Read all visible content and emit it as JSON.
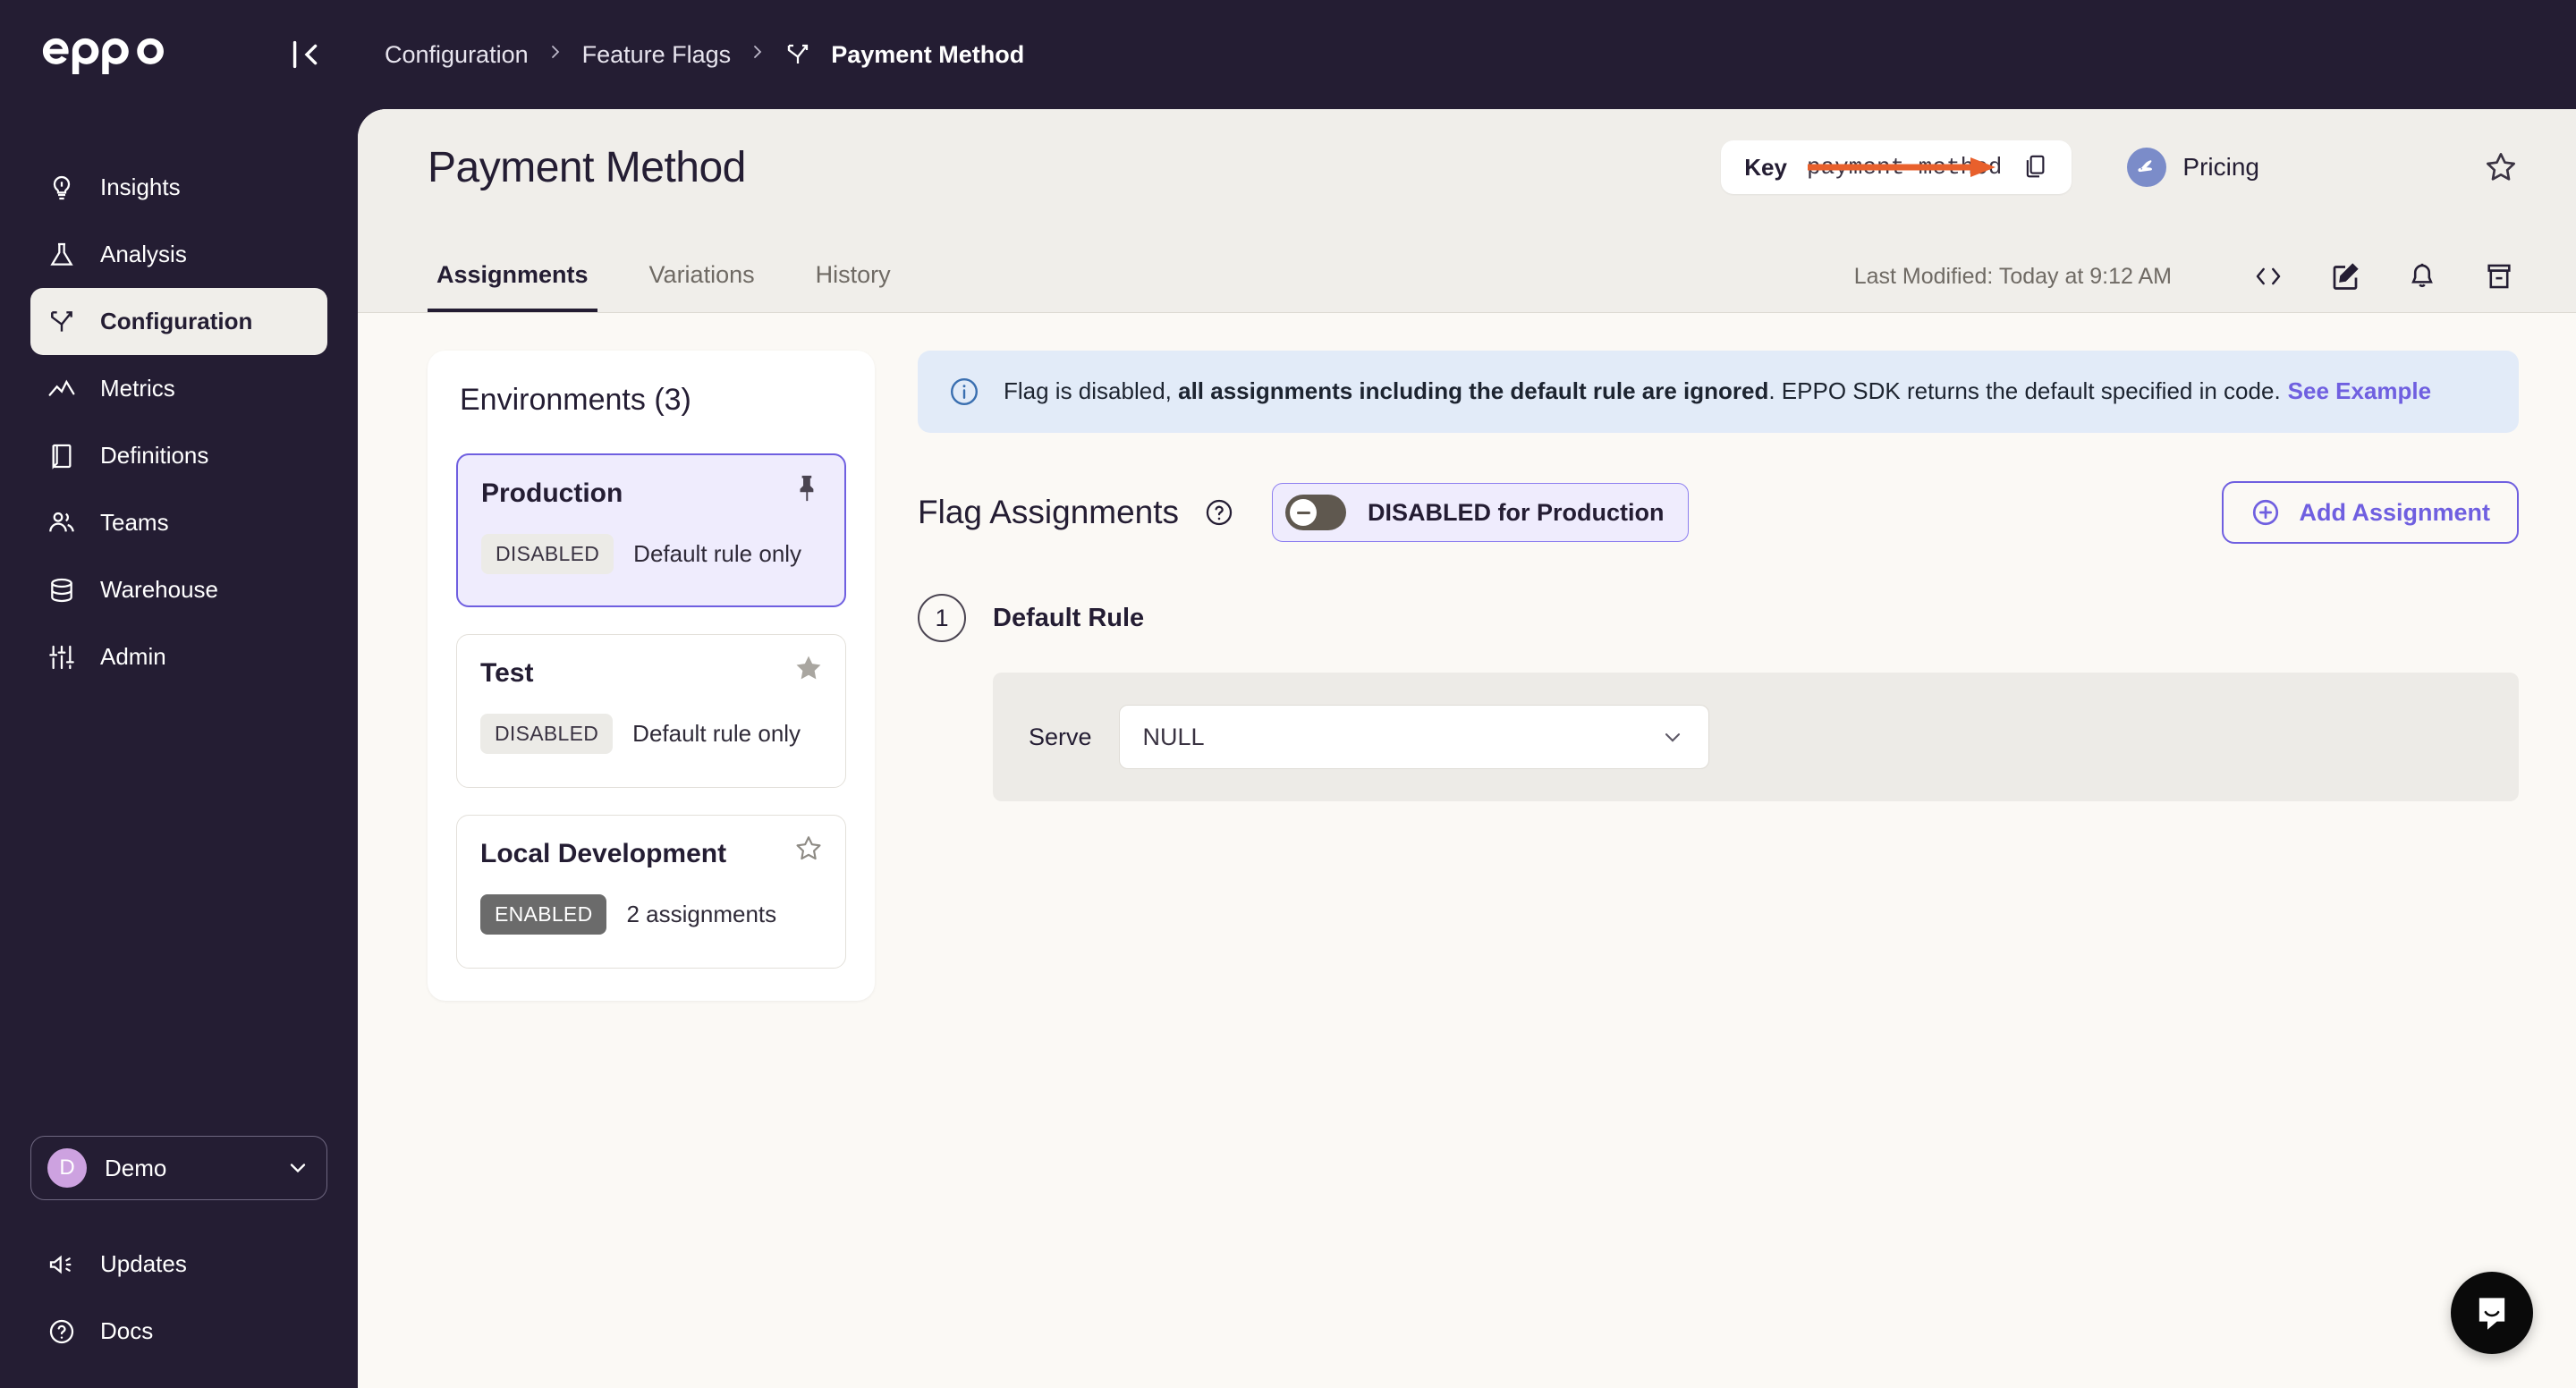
{
  "brand": {
    "logo_text": "eppo"
  },
  "topbar": {
    "collapse_icon": "collapse-panel-icon",
    "breadcrumb": [
      {
        "label": "Configuration",
        "current": false
      },
      {
        "label": "Feature Flags",
        "current": false
      },
      {
        "label": "Payment Method",
        "current": true
      }
    ],
    "separator": "›"
  },
  "sidebar": {
    "items": [
      {
        "label": "Insights",
        "icon": "lightbulb-icon",
        "active": false
      },
      {
        "label": "Analysis",
        "icon": "flask-icon",
        "active": false
      },
      {
        "label": "Configuration",
        "icon": "flag-branch-icon",
        "active": true
      },
      {
        "label": "Metrics",
        "icon": "trend-line-icon",
        "active": false
      },
      {
        "label": "Definitions",
        "icon": "book-icon",
        "active": false
      },
      {
        "label": "Teams",
        "icon": "people-icon",
        "active": false
      },
      {
        "label": "Warehouse",
        "icon": "database-icon",
        "active": false
      },
      {
        "label": "Admin",
        "icon": "sliders-icon",
        "active": false
      }
    ],
    "org": {
      "initial": "D",
      "name": "Demo",
      "caret_icon": "chevron-down-icon"
    },
    "bottom_items": [
      {
        "label": "Updates",
        "icon": "megaphone-icon"
      },
      {
        "label": "Docs",
        "icon": "question-circle-icon"
      }
    ]
  },
  "page": {
    "title": "Payment Method",
    "key_chip": {
      "label": "Key",
      "value": "payment-method",
      "copy_icon": "copy-icon"
    },
    "pricing": {
      "initial": "",
      "label": "Pricing",
      "avatar_icon": "alligator-avatar-icon",
      "avatar_color": "#7b8cc9"
    },
    "favorite_icon": "star-outline-icon"
  },
  "tabs": [
    {
      "label": "Assignments",
      "active": true
    },
    {
      "label": "Variations",
      "active": false
    },
    {
      "label": "History",
      "active": false
    }
  ],
  "tabs_right": {
    "last_modified": "Last Modified: Today at 9:12 AM",
    "icons": [
      {
        "name": "code-brackets-icon"
      },
      {
        "name": "edit-pencil-icon"
      },
      {
        "name": "bell-icon"
      },
      {
        "name": "archive-icon"
      }
    ]
  },
  "environments": {
    "title": "Environments (3)",
    "cards": [
      {
        "name": "Production",
        "status": "DISABLED",
        "status_kind": "disabled",
        "detail": "Default rule only",
        "mark": "pin-filled-icon",
        "selected": true
      },
      {
        "name": "Test",
        "status": "DISABLED",
        "status_kind": "disabled",
        "detail": "Default rule only",
        "mark": "star-filled-icon",
        "selected": false
      },
      {
        "name": "Local Development",
        "status": "ENABLED",
        "status_kind": "enabled",
        "detail": "2 assignments",
        "mark": "star-outline-icon",
        "selected": false
      }
    ]
  },
  "banner": {
    "icon": "info-circle-icon",
    "text_lead": "Flag is disabled,",
    "text_bold": " all assignments including the default rule are ignored",
    "text_tail": ". EPPO SDK returns the default specified in code.",
    "link": "See Example",
    "bg": "#e2ebf8"
  },
  "assignments": {
    "title": "Flag Assignments",
    "help_icon": "question-circle-icon",
    "toggle": {
      "label": "DISABLED for Production",
      "state": "off",
      "icon": "toggle-off-icon"
    },
    "add_button": {
      "label": "Add Assignment",
      "icon": "plus-circle-icon"
    }
  },
  "default_rule": {
    "number": "1",
    "title": "Default Rule",
    "serve_label": "Serve",
    "serve_value": "NULL",
    "caret_icon": "chevron-down-icon"
  },
  "chat": {
    "icon": "chat-bubble-icon"
  },
  "annotation": {
    "arrow": "orange-arrow-right",
    "color": "#e8602c"
  },
  "colors": {
    "sidebar_bg": "#241d33",
    "page_bg": "#fbf9f5",
    "head_bg": "#f0eeea",
    "accent_purple": "#6f5fe0",
    "banner_blue": "#e2ebf8",
    "annotation_orange": "#e8602c"
  }
}
